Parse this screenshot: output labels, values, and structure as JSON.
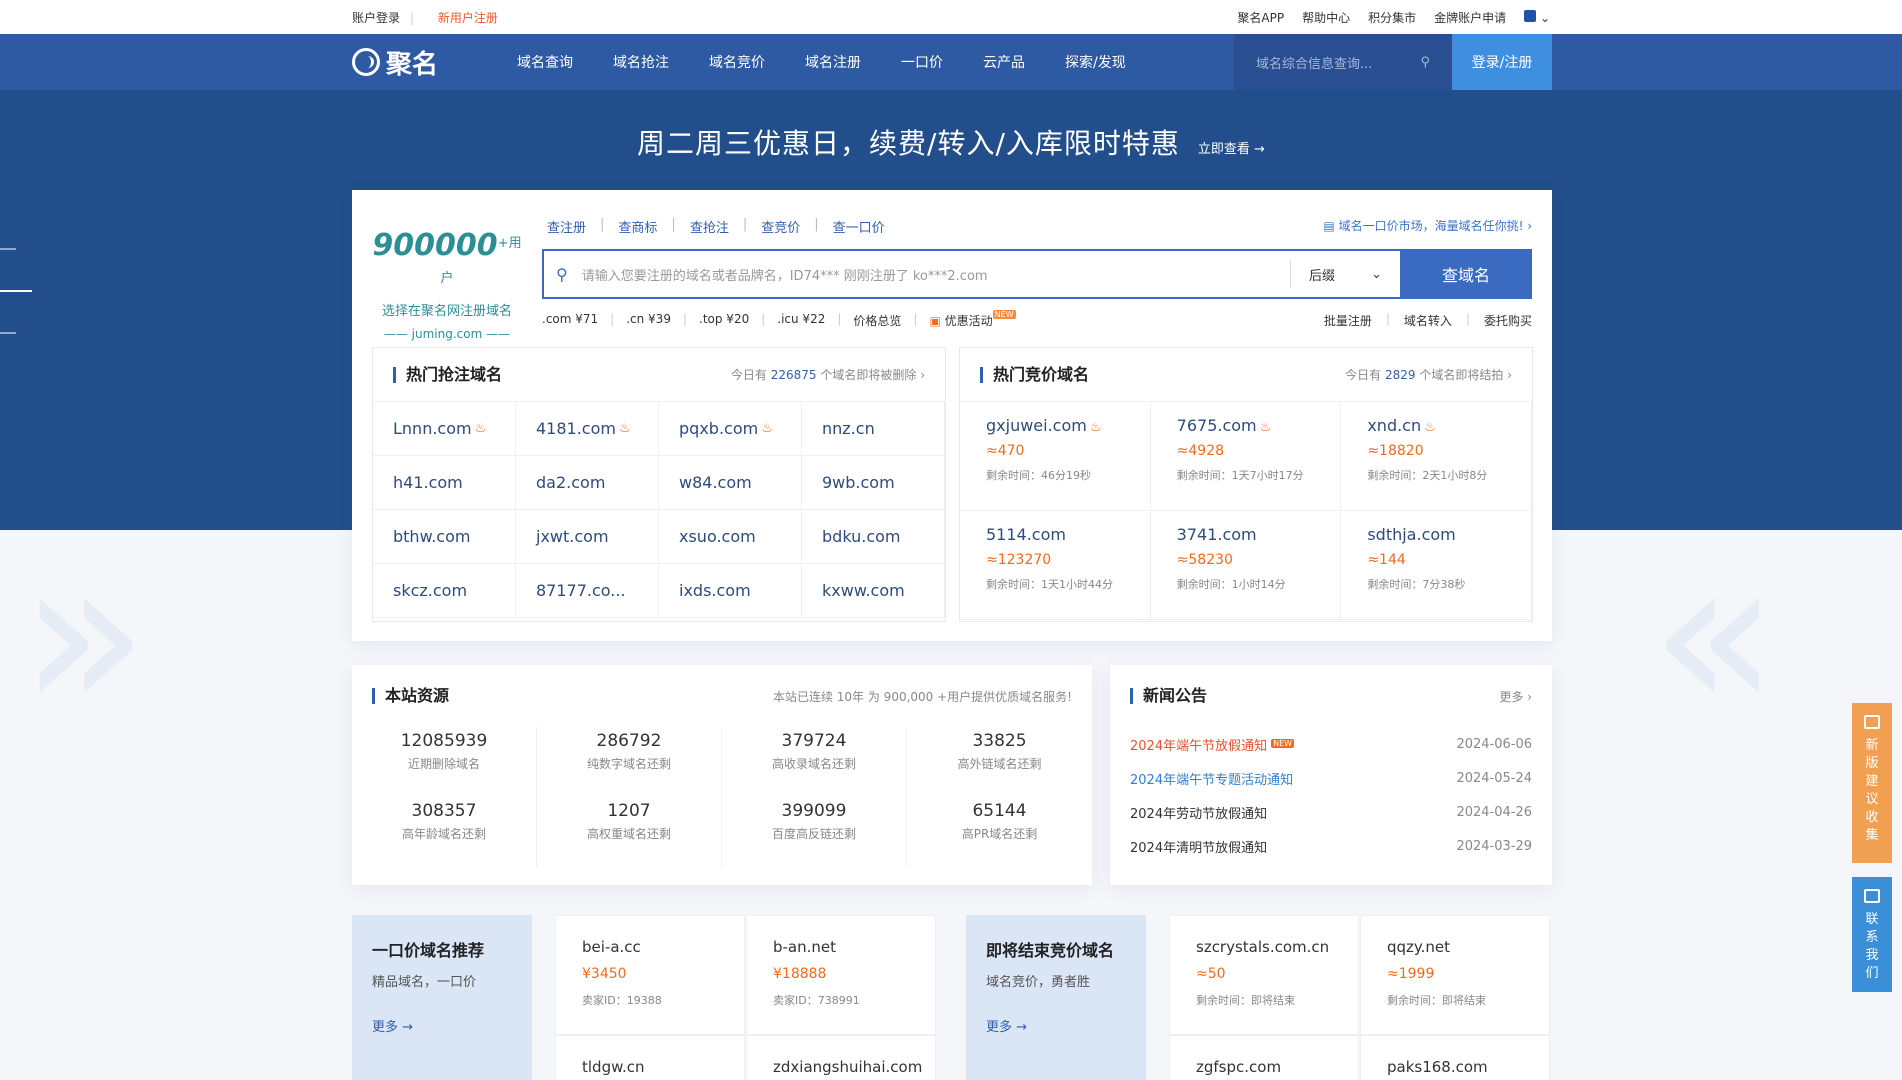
{
  "topbar": {
    "login": "账户登录",
    "register": "新用户注册",
    "right": [
      "聚名APP",
      "帮助中心",
      "积分集市",
      "金牌账户申请"
    ]
  },
  "nav": {
    "logo": "聚名",
    "menu": [
      "域名查询",
      "域名抢注",
      "域名竞价",
      "域名注册",
      "一口价",
      "云产品",
      "探索/发现"
    ],
    "search_placeholder": "域名综合信息查询...",
    "login": "登录/注册"
  },
  "banner": {
    "title": "周二周三优惠日，续费/转入/入库限时特惠",
    "more": "立即查看 →"
  },
  "main": {
    "users": "900000",
    "users_suffix": "+用户",
    "users_sub": "选择在聚名网注册域名",
    "site": "juming.com",
    "tabs": [
      "查注册",
      "查商标",
      "查抢注",
      "查竞价",
      "查一口价"
    ],
    "promo": "域名一口价市场，海量域名任你挑!",
    "search_placeholder": "请输入您要注册的域名或者品牌名，ID74*** 刚刚注册了 ko***2.com",
    "suffix": "后缀",
    "search_btn": "查域名",
    "prices": [
      ".com ¥71",
      ".cn ¥39",
      ".top ¥20",
      ".icu ¥22",
      "价格总览",
      "优惠活动"
    ],
    "new_badge": "NEW",
    "quick": [
      "批量注册",
      "域名转入",
      "委托购买"
    ],
    "snipe": {
      "title": "热门抢注域名",
      "count_pre": "今日有",
      "count": "226875",
      "count_post": "个域名即将被删除",
      "domains": [
        "Lnnn.com",
        "4181.com",
        "pqxb.com",
        "nnz.cn",
        "h41.com",
        "da2.com",
        "w84.com",
        "9wb.com",
        "bthw.com",
        "jxwt.com",
        "xsuo.com",
        "bdku.com",
        "skcz.com",
        "87177.co...",
        "ixds.com",
        "kxww.com"
      ]
    },
    "auction": {
      "title": "热门竞价域名",
      "count_pre": "今日有",
      "count": "2829",
      "count_post": "个域名即将结拍",
      "items": [
        {
          "domain": "gxjuwei.com",
          "price": "≈470",
          "time": "剩余时间：46分19秒"
        },
        {
          "domain": "7675.com",
          "price": "≈4928",
          "time": "剩余时间：1天7小时17分"
        },
        {
          "domain": "xnd.cn",
          "price": "≈18820",
          "time": "剩余时间：2天1小时8分"
        },
        {
          "domain": "5114.com",
          "price": "≈123270",
          "time": "剩余时间：1天1小时44分"
        },
        {
          "domain": "3741.com",
          "price": "≈58230",
          "time": "剩余时间：1小时14分"
        },
        {
          "domain": "sdthja.com",
          "price": "≈144",
          "time": "剩余时间：7分38秒"
        }
      ]
    }
  },
  "resources": {
    "title": "本站资源",
    "caption": "本站已连续 10年 为 900,000 +用户提供优质域名服务!",
    "stats": [
      {
        "v": "12085939",
        "l": "近期删除域名"
      },
      {
        "v": "286792",
        "l": "纯数字域名还剩"
      },
      {
        "v": "379724",
        "l": "高收录域名还剩"
      },
      {
        "v": "33825",
        "l": "高外链域名还剩"
      },
      {
        "v": "308357",
        "l": "高年龄域名还剩"
      },
      {
        "v": "1207",
        "l": "高权重域名还剩"
      },
      {
        "v": "399099",
        "l": "百度高反链还剩"
      },
      {
        "v": "65144",
        "l": "高PR域名还剩"
      }
    ]
  },
  "news": {
    "title": "新闻公告",
    "more": "更多",
    "items": [
      {
        "t": "2024年端午节放假通知",
        "d": "2024-06-06",
        "color": "#e8522d"
      },
      {
        "t": "2024年端午节专题活动通知",
        "d": "2024-05-24",
        "color": "#2f7fd0"
      },
      {
        "t": "2024年劳动节放假通知",
        "d": "2024-04-26",
        "color": "#333333"
      },
      {
        "t": "2024年清明节放假通知",
        "d": "2024-03-29",
        "color": "#333333"
      }
    ]
  },
  "fixed": {
    "title": "一口价域名推荐",
    "sub": "精品域名，一口价",
    "more": "更多 →",
    "items": [
      {
        "domain": "bei-a.cc",
        "price": "¥3450",
        "seller": "卖家ID：19388"
      },
      {
        "domain": "b-an.net",
        "price": "¥18888",
        "seller": "卖家ID：738991"
      }
    ],
    "row2": [
      "tldgw.cn",
      "zdxiangshuihai.com"
    ]
  },
  "ending": {
    "title": "即将结束竞价域名",
    "sub": "域名竞价，勇者胜",
    "more": "更多 →",
    "items": [
      {
        "domain": "szcrystals.com.cn",
        "price": "≈50",
        "time": "剩余时间：即将结束"
      },
      {
        "domain": "qqzy.net",
        "price": "≈1999",
        "time": "剩余时间：即将结束"
      }
    ],
    "row2": [
      "zgfspc.com",
      "paks168.com"
    ]
  },
  "float": {
    "feedback": "新版建议收集",
    "contact": "联系我们"
  }
}
